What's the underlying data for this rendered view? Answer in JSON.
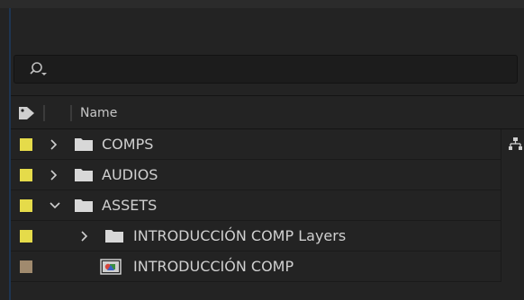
{
  "search": {
    "placeholder": "",
    "value": ""
  },
  "header": {
    "name_label": "Name"
  },
  "colors": {
    "label_yellow": "#e5db4a",
    "label_tan": "#a08a6e",
    "folder": "#d8d8d8"
  },
  "items": [
    {
      "name": "COMPS",
      "type": "folder",
      "expanded": false,
      "label_color": "#e5db4a",
      "depth": 0
    },
    {
      "name": "AUDIOS",
      "type": "folder",
      "expanded": false,
      "label_color": "#e5db4a",
      "depth": 0
    },
    {
      "name": "ASSETS",
      "type": "folder",
      "expanded": true,
      "label_color": "#e5db4a",
      "depth": 0
    },
    {
      "name": "INTRODUCCIÓN COMP Layers",
      "type": "folder",
      "expanded": false,
      "label_color": "#e5db4a",
      "depth": 1
    },
    {
      "name": "INTRODUCCIÓN COMP",
      "type": "composition",
      "expanded": false,
      "label_color": "#a08a6e",
      "depth": 1
    }
  ],
  "icons": {
    "search": "search-icon",
    "label": "tag-icon",
    "flowchart": "flowchart-icon",
    "folder": "folder-icon",
    "composition": "composition-icon"
  }
}
